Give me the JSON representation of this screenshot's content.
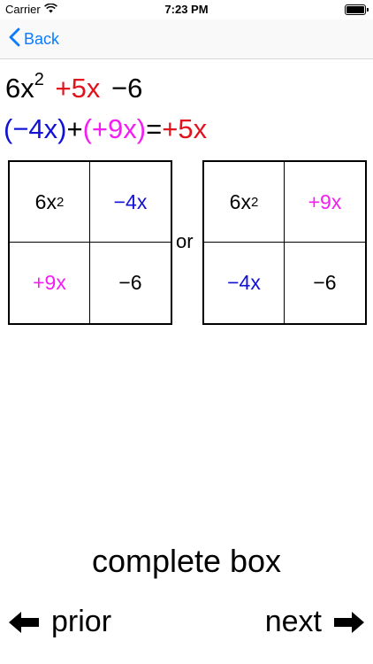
{
  "status_bar": {
    "carrier": "Carrier",
    "time": "7:23 PM"
  },
  "nav": {
    "back_label": "Back"
  },
  "expression": {
    "term1": "6x",
    "term1_exp": "2",
    "term2": "+5x",
    "term3": "−6"
  },
  "sum": {
    "left": "(−4x)",
    "plus": "+",
    "right": "(+9x)",
    "equals": "=",
    "result": "+5x"
  },
  "grid_left": {
    "top_left": "6x",
    "top_left_exp": "2",
    "top_right": "−4x",
    "bottom_left": "+9x",
    "bottom_right": "−6"
  },
  "separator": "or",
  "grid_right": {
    "top_left": "6x",
    "top_left_exp": "2",
    "top_right": "+9x",
    "bottom_left": "−4x",
    "bottom_right": "−6"
  },
  "actions": {
    "complete_label": "complete box",
    "prior_label": "prior",
    "next_label": "next"
  },
  "colors": {
    "red": "#e1141e",
    "blue": "#1212d6",
    "magenta": "#f21ef2",
    "ios_blue": "#0a7aff"
  }
}
